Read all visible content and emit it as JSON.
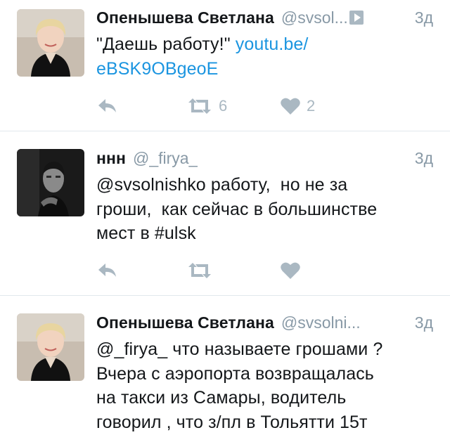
{
  "tweets": [
    {
      "display_name": "Опенышева Светлана",
      "handle": "@svsol...",
      "has_video_badge": true,
      "time": "3д",
      "text_plain": "\"Даешь работу!\" ",
      "link_text": "youtu.be/\neBSK9OBgeoE",
      "retweet_count": "6",
      "like_count": "2"
    },
    {
      "display_name": "ннн",
      "handle": "@_firya_",
      "time": "3д",
      "text_plain": "@svsolnishko работу,  но не за\nгроши,  как сейчас в большинстве\nмест в #ulsk",
      "retweet_count": "",
      "like_count": ""
    },
    {
      "display_name": "Опенышева Светлана",
      "handle": "@svsolni...",
      "time": "3д",
      "text_plain": "@_firya_ что называете грошами ?\nВчера с аэропорта возвращалась\nна такси из Самары, водитель\nговорил , что з/пл в Тольятти 15т"
    }
  ],
  "icons": {
    "reply": "reply-arrow-icon",
    "retweet": "retweet-icon",
    "like": "heart-icon",
    "video": "play-video-icon"
  },
  "colors": {
    "text": "#14171a",
    "secondary": "#8899a6",
    "link": "#1b95e0",
    "action_gray": "#aab8c2",
    "divider": "#e1e8ed"
  }
}
